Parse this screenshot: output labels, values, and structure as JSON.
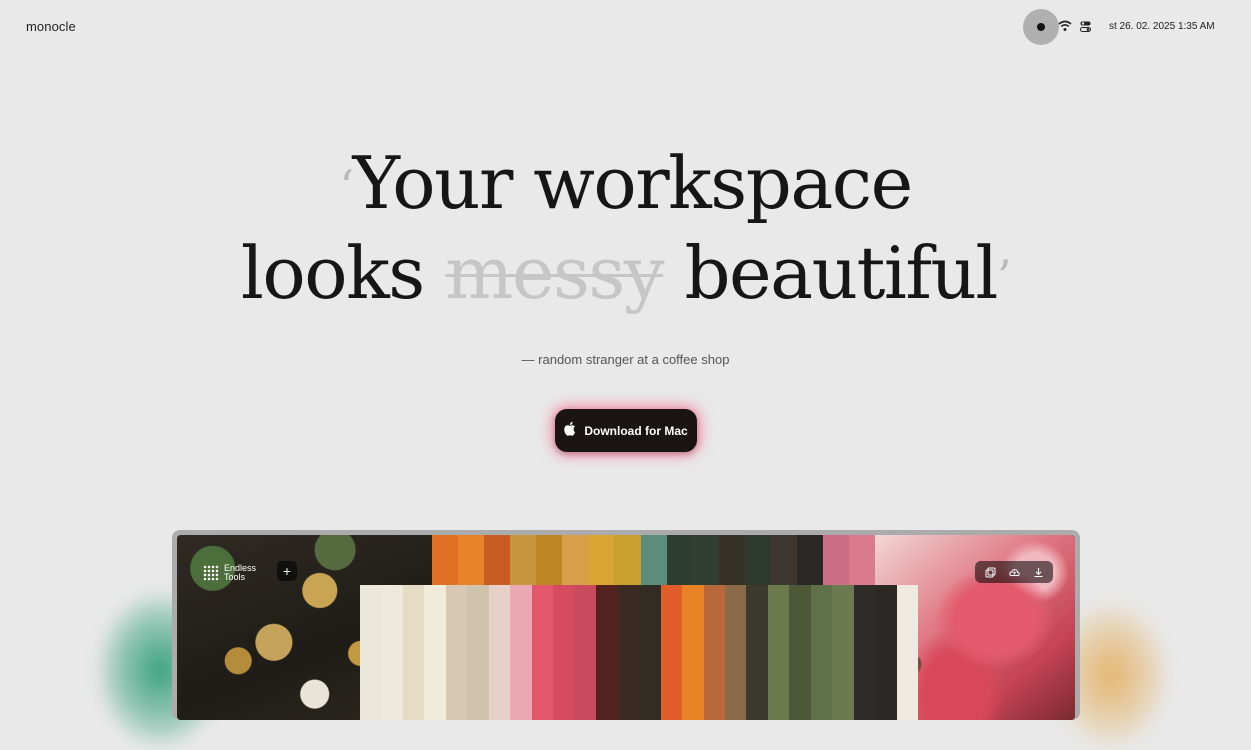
{
  "header": {
    "brand": "monocle",
    "datetime": "st 26. 02. 2025  1:35 AM"
  },
  "headline": {
    "open_quote": "‘",
    "line1": "Your workspace",
    "line2_before": "looks",
    "struck_word": "messy",
    "line2_after": "beautiful",
    "close_quote": "’"
  },
  "attribution": "— random stranger at a coffee shop",
  "cta": {
    "label": "Download for Mac",
    "icon": "apple-icon"
  },
  "preview": {
    "app_name_line1": "Endless",
    "app_name_line2": "Tools",
    "add_label": "+",
    "toolbar_icons": [
      "copy-icon",
      "cloud-icon",
      "download-icon"
    ],
    "palette_top": [
      "#e07024",
      "#e8832a",
      "#c95c22",
      "#c8963c",
      "#bf8626",
      "#d7a048",
      "#d9a535",
      "#c9a02f",
      "#5c8d7c",
      "#2c3e32",
      "#313e33",
      "#363228",
      "#2e3a2d",
      "#3e3731",
      "#2a2826",
      "#cc6f86",
      "#d97b8c"
    ],
    "palette_main": [
      "#ece7db",
      "#efe9dc",
      "#e5dcc6",
      "#f0ecd9",
      "#d8c8b2",
      "#cfc3ae",
      "#e7d0c8",
      "#eaa9b4",
      "#e2576a",
      "#d44c5e",
      "#c74a5d",
      "#52231f",
      "#3a2a23",
      "#312c24",
      "#e15e2a",
      "#e88426",
      "#b9683c",
      "#8a6a48",
      "#3c3a2e",
      "#6b7a4a",
      "#4c5838",
      "#5f7148",
      "#6c7a52",
      "#2e2b28",
      "#2a2724",
      "#efeae0"
    ]
  }
}
